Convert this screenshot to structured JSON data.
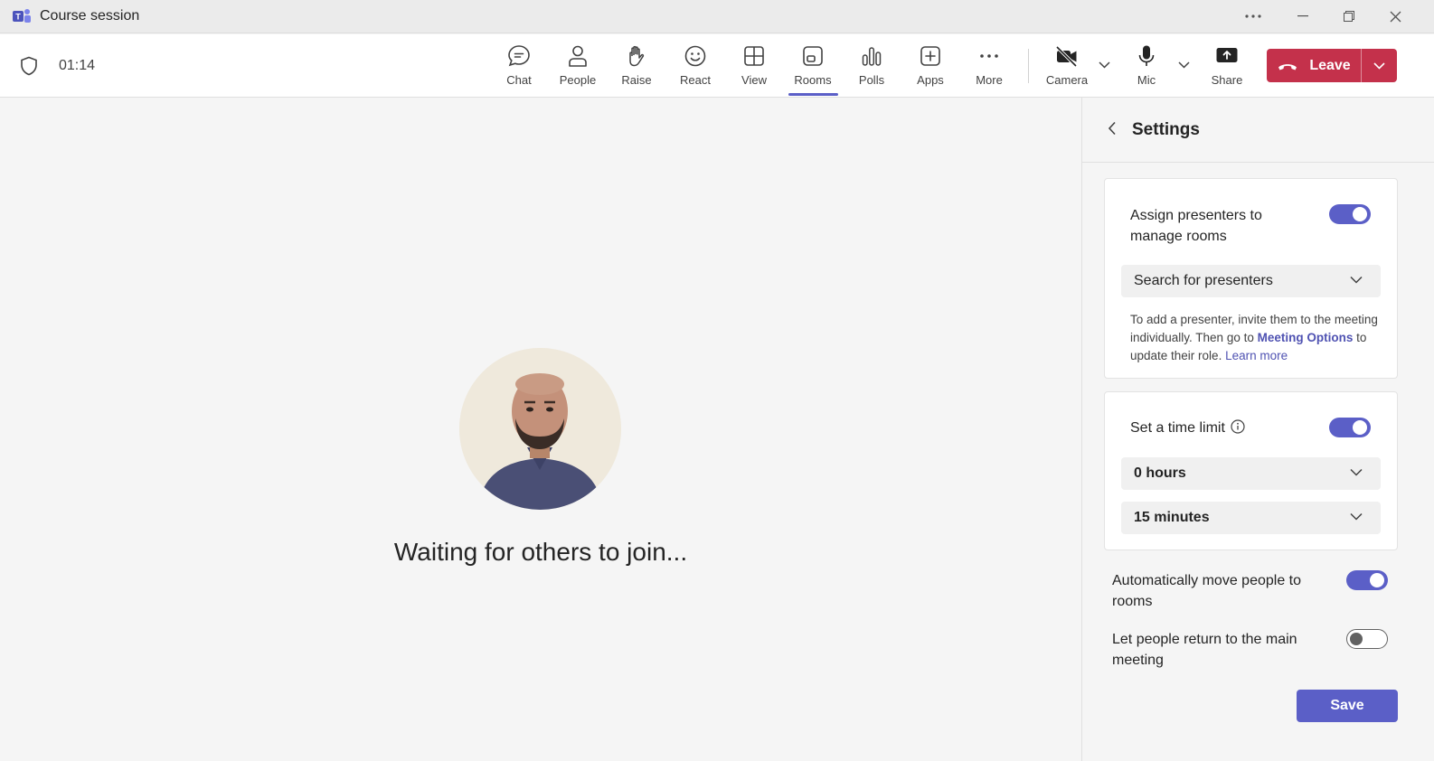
{
  "window": {
    "title": "Course session",
    "more_icon": "more-horizontal-icon",
    "minimize_icon": "minimize-icon",
    "restore_icon": "restore-icon",
    "close_icon": "close-icon"
  },
  "toolbar": {
    "timer": "01:14",
    "items": [
      {
        "label": "Chat",
        "icon": "chat-icon"
      },
      {
        "label": "People",
        "icon": "people-icon"
      },
      {
        "label": "Raise",
        "icon": "raise-hand-icon"
      },
      {
        "label": "React",
        "icon": "react-smiley-icon"
      },
      {
        "label": "View",
        "icon": "view-grid-icon"
      },
      {
        "label": "Rooms",
        "icon": "rooms-icon",
        "active": true
      },
      {
        "label": "Polls",
        "icon": "polls-icon"
      },
      {
        "label": "Apps",
        "icon": "apps-icon"
      },
      {
        "label": "More",
        "icon": "more-icon"
      }
    ],
    "camera": {
      "label": "Camera",
      "icon": "camera-off-icon"
    },
    "mic": {
      "label": "Mic",
      "icon": "mic-icon"
    },
    "share": {
      "label": "Share",
      "icon": "share-icon"
    },
    "leave": {
      "label": "Leave",
      "icon": "hang-up-icon"
    }
  },
  "stage": {
    "waiting_text": "Waiting for others to join..."
  },
  "panel": {
    "title": "Settings",
    "assign_presenters": {
      "label": "Assign presenters to manage rooms",
      "enabled": true,
      "search_placeholder": "Search for presenters",
      "help_pre": "To add a presenter, invite them to the meeting individually. Then go to ",
      "help_link_strong": "Meeting Options",
      "help_mid": " to update their role. ",
      "help_link": "Learn more"
    },
    "time_limit": {
      "label": "Set a time limit",
      "enabled": true,
      "hours": "0 hours",
      "minutes": "15 minutes"
    },
    "auto_move": {
      "label": "Automatically move people to rooms",
      "enabled": true
    },
    "let_return": {
      "label": "Let people return to the main meeting",
      "enabled": false
    },
    "save_label": "Save"
  },
  "colors": {
    "accent": "#5b5fc7",
    "leave": "#c4314b",
    "background": "#f5f5f5"
  }
}
